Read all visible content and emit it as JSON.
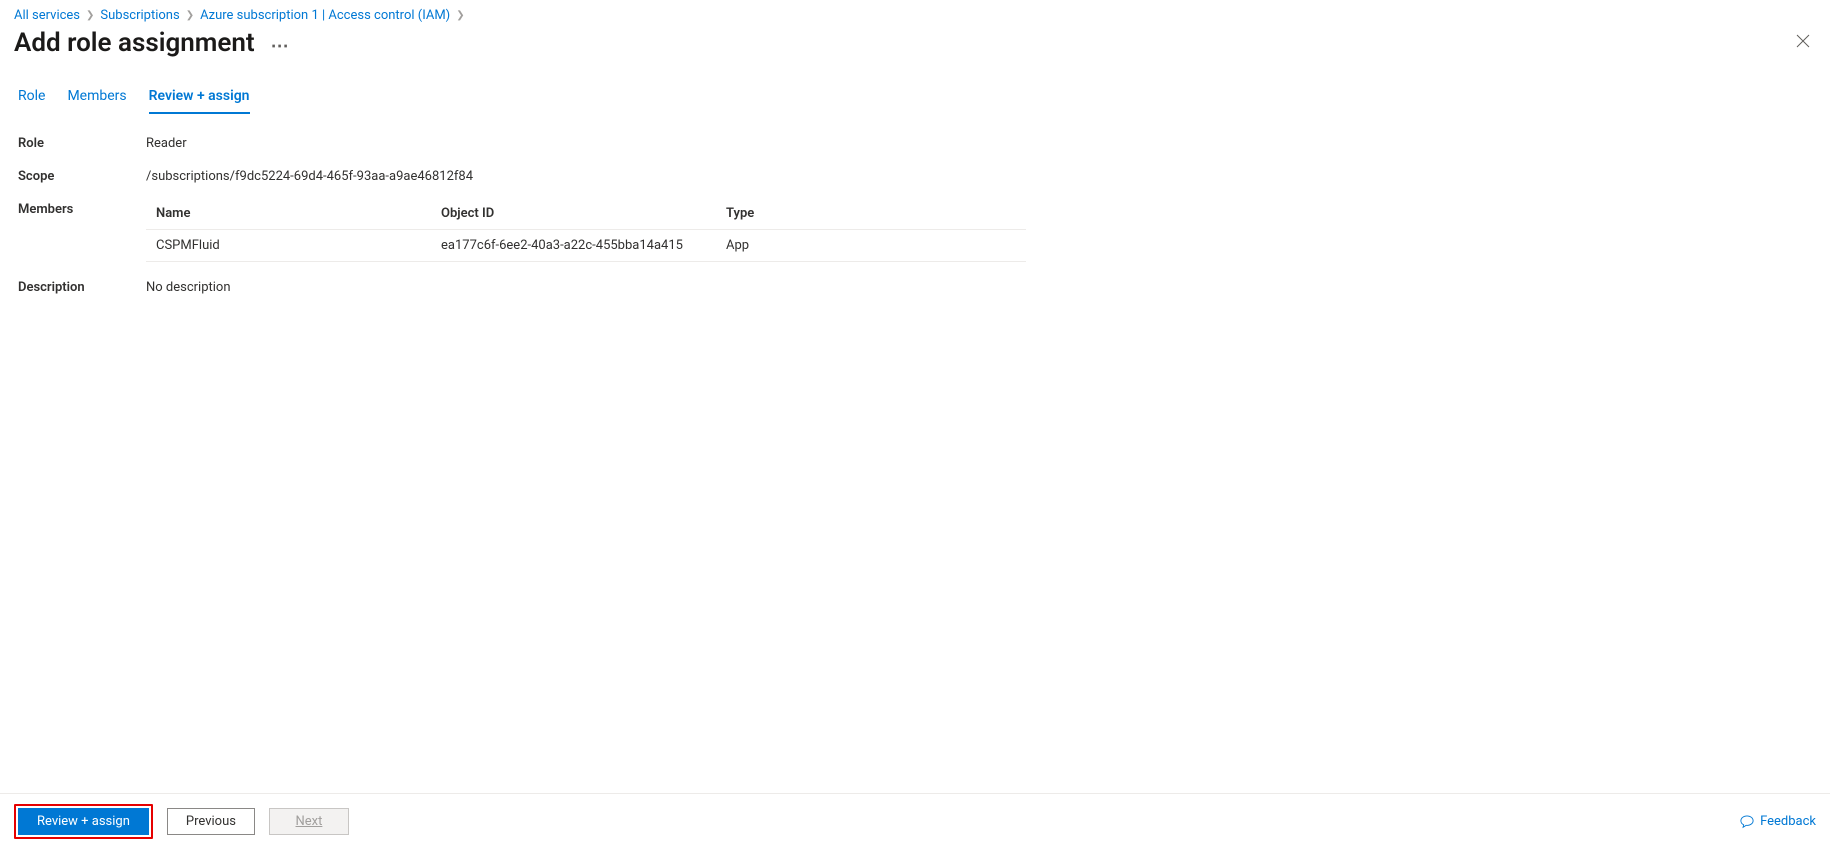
{
  "breadcrumb": {
    "items": [
      {
        "label": "All services"
      },
      {
        "label": "Subscriptions"
      },
      {
        "label": "Azure subscription 1 | Access control (IAM)"
      }
    ]
  },
  "header": {
    "title": "Add role assignment"
  },
  "tabs": {
    "role": "Role",
    "members": "Members",
    "review": "Review + assign"
  },
  "details": {
    "role_label": "Role",
    "role_value": "Reader",
    "scope_label": "Scope",
    "scope_value": "/subscriptions/f9dc5224-69d4-465f-93aa-a9ae46812f84",
    "members_label": "Members",
    "description_label": "Description",
    "description_value": "No description"
  },
  "members_table": {
    "headers": {
      "name": "Name",
      "object_id": "Object ID",
      "type": "Type"
    },
    "rows": [
      {
        "name": "CSPMFluid",
        "object_id": "ea177c6f-6ee2-40a3-a22c-455bba14a415",
        "type": "App"
      }
    ]
  },
  "footer": {
    "review_assign": "Review + assign",
    "previous": "Previous",
    "next": "Next",
    "feedback": "Feedback"
  }
}
